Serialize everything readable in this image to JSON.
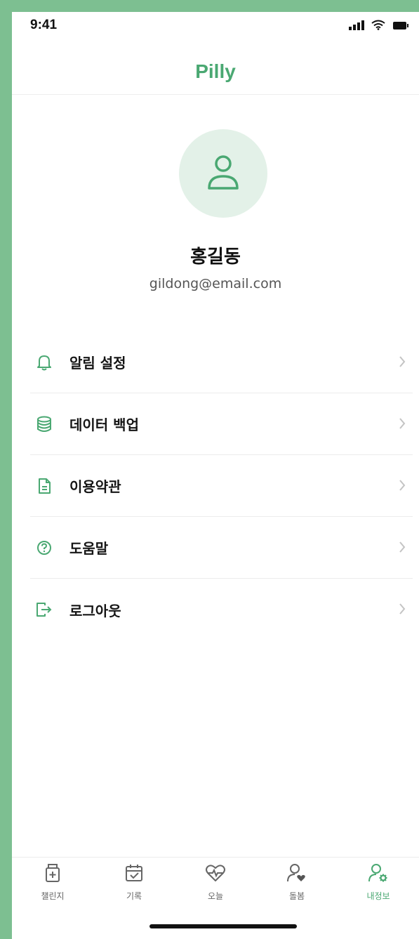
{
  "status_bar": {
    "time": "9:41",
    "icons": [
      "signal-icon",
      "wifi-icon",
      "battery-icon"
    ]
  },
  "header": {
    "title": "Pilly"
  },
  "profile": {
    "avatar_icon": "user-icon",
    "name": "홍길동",
    "email": "gildong@email.com"
  },
  "menu": {
    "items": [
      {
        "label": "알림 설정",
        "icon": "bell-icon"
      },
      {
        "label": "데이터 백업",
        "icon": "database-icon"
      },
      {
        "label": "이용약관",
        "icon": "document-icon"
      },
      {
        "label": "도움말",
        "icon": "help-icon"
      },
      {
        "label": "로그아웃",
        "icon": "logout-icon"
      }
    ]
  },
  "tab_bar": {
    "items": [
      {
        "label": "챌린지",
        "icon": "pill-bottle-icon"
      },
      {
        "label": "기록",
        "icon": "calendar-check-icon"
      },
      {
        "label": "오늘",
        "icon": "heart-pulse-icon"
      },
      {
        "label": "돌봄",
        "icon": "user-heart-icon"
      },
      {
        "label": "내정보",
        "icon": "user-settings-icon",
        "active": true
      }
    ]
  },
  "colors": {
    "accent": "#4aa872",
    "avatar_bg": "#e3f1e8",
    "frame": "#7dbf91"
  }
}
